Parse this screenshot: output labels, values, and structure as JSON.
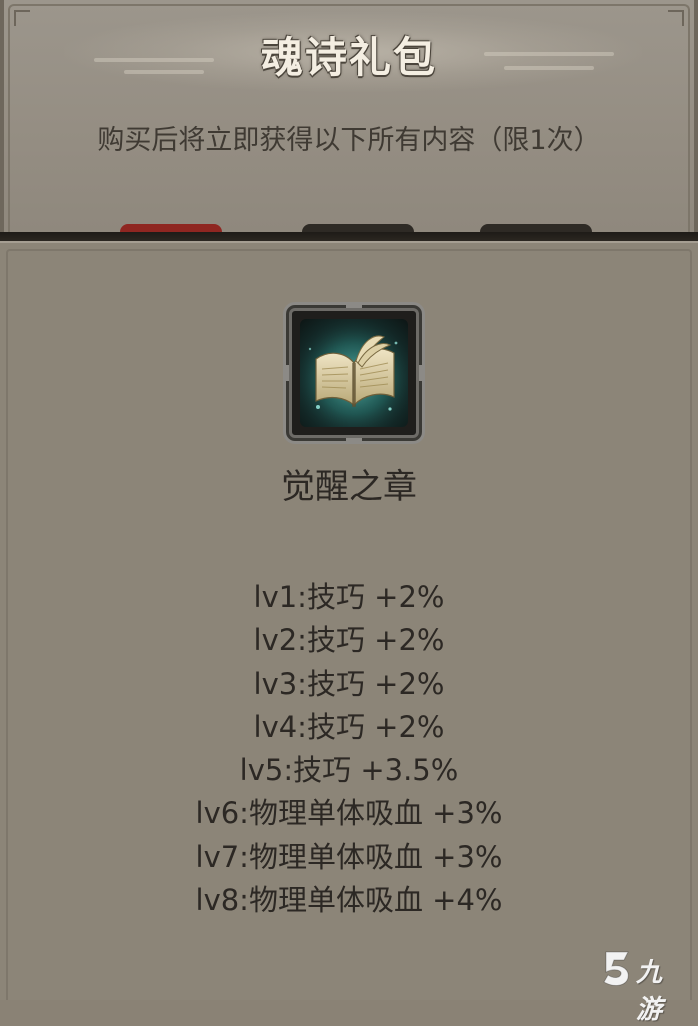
{
  "dialog": {
    "title": "魂诗礼包",
    "subtitle": "购买后将立即获得以下所有内容（限1次）"
  },
  "item": {
    "icon": "book-icon",
    "name": "觉醒之章",
    "levels": [
      "lv1:技巧 +2%",
      "lv2:技巧 +2%",
      "lv3:技巧 +2%",
      "lv4:技巧 +2%",
      "lv5:技巧 +3.5%",
      "lv6:物理单体吸血 +3%",
      "lv7:物理单体吸血 +3%",
      "lv8:物理单体吸血 +4%"
    ]
  },
  "watermark": {
    "logo": "jiuyou-logo-icon",
    "text": "九游"
  },
  "colors": {
    "panel_background": "#8c8578",
    "header_background": "#978f84",
    "title_text": "#f4eee2",
    "body_text": "#2c2824",
    "divider": "#1e1b17",
    "tab_red": "#8f2621",
    "tab_dark": "#2e2a25"
  }
}
